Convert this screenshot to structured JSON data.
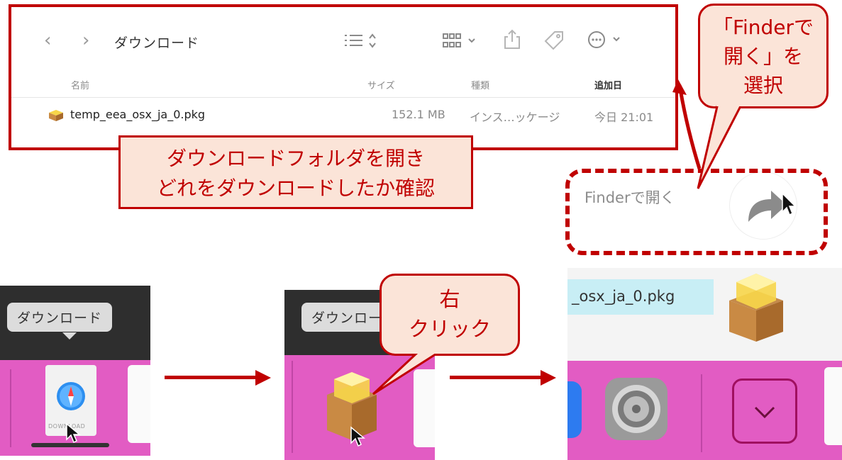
{
  "finder": {
    "folder_title": "ダウンロード",
    "columns": {
      "name": "名前",
      "size": "サイズ",
      "kind": "種類",
      "date_added": "追加日"
    },
    "file": {
      "name": "temp_eea_osx_ja_0.pkg",
      "size": "152.1 MB",
      "kind": "インス…ッケージ",
      "date_added": "今日 21:01"
    }
  },
  "callouts": {
    "check_download": [
      "ダウンロードフォルダを開き",
      "どれをダウンロードしたか確認"
    ],
    "right_click": [
      "右",
      "クリック"
    ],
    "open_in_finder": [
      "「Finderで",
      "開く」を",
      "選択"
    ]
  },
  "dock": {
    "tooltip_1": "ダウンロード",
    "tooltip_2": "ダウンロード",
    "download_badge": "DOWNLOAD"
  },
  "context_menu": {
    "item": "Finderで開く",
    "file_label": "_osx_ja_0.pkg"
  },
  "colors": {
    "accent": "#c00000",
    "callout_fill": "#fbe4d8",
    "dock": "#e25cc3"
  }
}
